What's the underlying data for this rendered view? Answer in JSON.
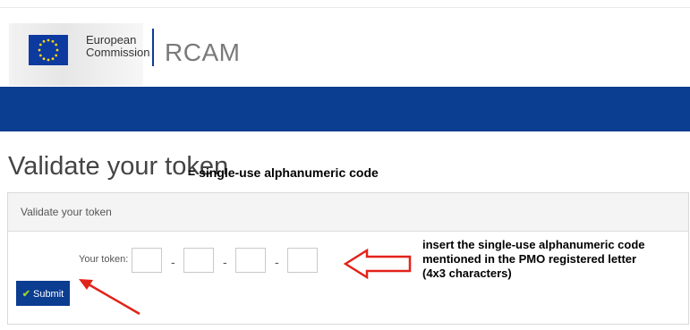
{
  "header": {
    "org_line1": "European",
    "org_line2": "Commission",
    "app_name": "RCAM"
  },
  "page": {
    "title": "Validate your token",
    "title_annotation": "= single-use alphanumeric code"
  },
  "panel": {
    "heading": "Validate your token",
    "token_label": "Your token:",
    "segments": [
      "",
      "",
      "",
      ""
    ],
    "separator": "-",
    "submit_label": "Submit",
    "submit_icon": "check-icon"
  },
  "annotation": {
    "line1": "insert the single-use alphanumeric code",
    "line2": "mentioned in the PMO registered letter",
    "line3": "(4x3 characters)"
  },
  "colors": {
    "brand_blue": "#0b3d91",
    "arrow_red": "#e2231a",
    "check_green": "#9ed32b"
  }
}
